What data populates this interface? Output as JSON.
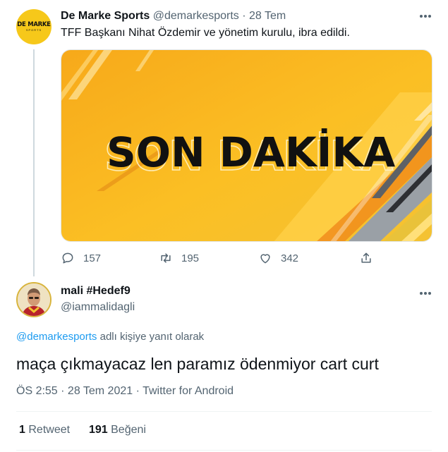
{
  "original_tweet": {
    "avatar_text_main": "DE MARKE",
    "avatar_text_sub": "SPORTS",
    "author_name": "De Marke Sports",
    "author_handle": "@demarkesports",
    "separator": "·",
    "date": "28 Tem",
    "text": "TFF Başkanı Nihat Özdemir ve yönetim kurulu, ibra edildi.",
    "image_text": "SON DAKİKA",
    "replies": "157",
    "retweets": "195",
    "likes": "342"
  },
  "reply_tweet": {
    "author_name": "mali #Hedef9",
    "author_handle": "@iammalidagli",
    "replying_mention": "@demarkesports",
    "replying_suffix": " adlı kişiye yanıt olarak",
    "text": "maça çıkmayacaz len paramız ödenmiyor cart curt",
    "time": "ÖS 2:55",
    "separator1": " · ",
    "date": "28 Tem 2021",
    "separator2": " · ",
    "source": "Twitter for Android",
    "retweet_count": "1",
    "retweet_label": "Retweet",
    "like_count": "191",
    "like_label": "Beğeni"
  },
  "colors": {
    "accent": "#1d9bf0",
    "banner_yellow": "#f9b31b",
    "text_secondary": "#536471"
  }
}
